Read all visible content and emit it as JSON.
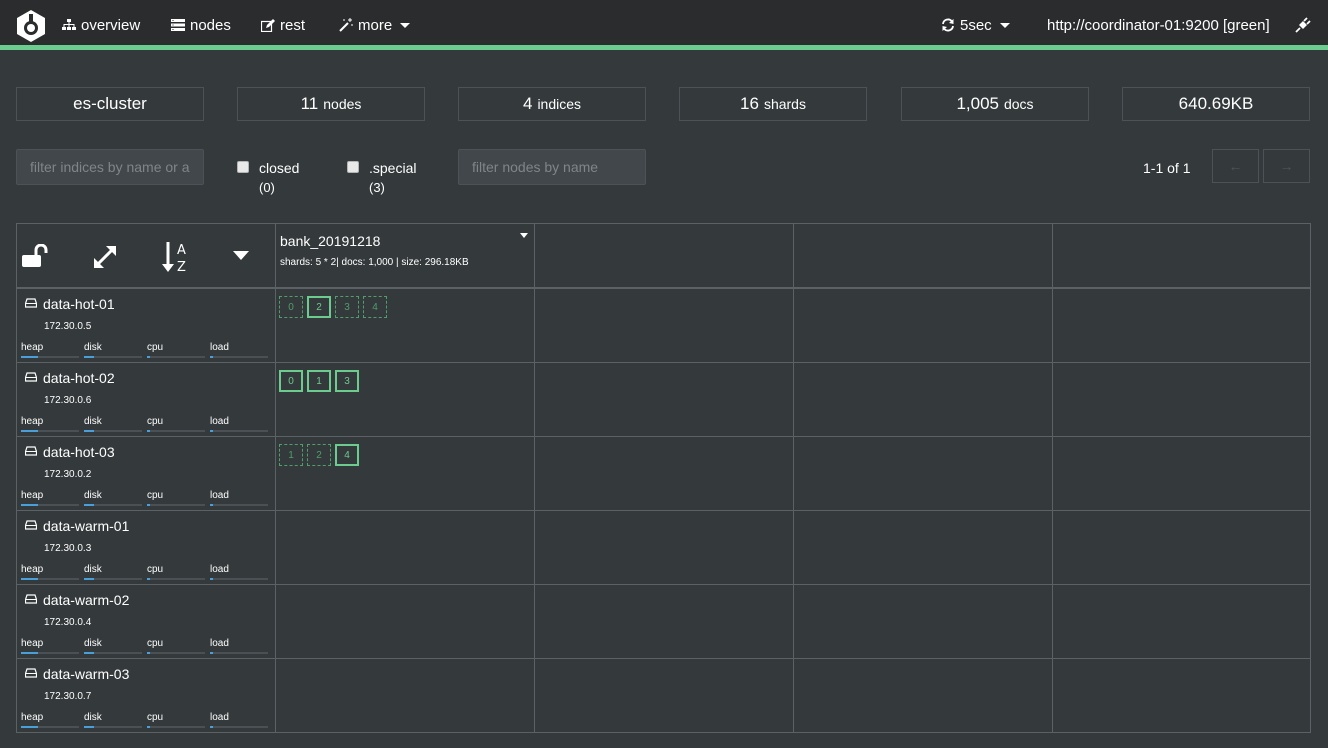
{
  "nav": {
    "overview": "overview",
    "nodes": "nodes",
    "rest": "rest",
    "more": "more",
    "refresh": "5sec",
    "connection": "http://coordinator-01:9200 [green]"
  },
  "stats": {
    "cluster_name": "es-cluster",
    "nodes_count": "11",
    "nodes_label": "nodes",
    "indices_count": "4",
    "indices_label": "indices",
    "shards_count": "16",
    "shards_label": "shards",
    "docs_count": "1,005",
    "docs_label": "docs",
    "size": "640.69KB"
  },
  "filters": {
    "indices_placeholder": "filter indices by name or aliases",
    "closed_label": "closed",
    "closed_count": "(0)",
    "special_label": ".special",
    "special_count": "(3)",
    "nodes_placeholder": "filter nodes by name"
  },
  "pager": {
    "text": "1-1 of 1",
    "prev": "←",
    "next": "→"
  },
  "index": {
    "name": "bank_20191218",
    "meta": "shards: 5 * 2| docs: 1,000 | size: 296.18KB"
  },
  "metric_labels": {
    "heap": "heap",
    "disk": "disk",
    "cpu": "cpu",
    "load": "load"
  },
  "nodes": [
    {
      "name": "data-hot-01",
      "ip": "172.30.0.5",
      "heap": 0.3,
      "disk": 0.17,
      "cpu": 0.05,
      "load": 0.05,
      "shards": [
        {
          "n": "0",
          "p": false
        },
        {
          "n": "2",
          "p": true
        },
        {
          "n": "3",
          "p": false
        },
        {
          "n": "4",
          "p": false
        }
      ]
    },
    {
      "name": "data-hot-02",
      "ip": "172.30.0.6",
      "heap": 0.3,
      "disk": 0.17,
      "cpu": 0.05,
      "load": 0.05,
      "shards": [
        {
          "n": "0",
          "p": true
        },
        {
          "n": "1",
          "p": true
        },
        {
          "n": "3",
          "p": true
        }
      ]
    },
    {
      "name": "data-hot-03",
      "ip": "172.30.0.2",
      "heap": 0.3,
      "disk": 0.17,
      "cpu": 0.05,
      "load": 0.05,
      "shards": [
        {
          "n": "1",
          "p": false
        },
        {
          "n": "2",
          "p": false
        },
        {
          "n": "4",
          "p": true
        }
      ]
    },
    {
      "name": "data-warm-01",
      "ip": "172.30.0.3",
      "heap": 0.3,
      "disk": 0.17,
      "cpu": 0.05,
      "load": 0.05,
      "shards": []
    },
    {
      "name": "data-warm-02",
      "ip": "172.30.0.4",
      "heap": 0.3,
      "disk": 0.17,
      "cpu": 0.05,
      "load": 0.05,
      "shards": []
    },
    {
      "name": "data-warm-03",
      "ip": "172.30.0.7",
      "heap": 0.3,
      "disk": 0.17,
      "cpu": 0.05,
      "load": 0.05,
      "shards": []
    }
  ],
  "colors": {
    "accent": "#6ccb8f",
    "metric_bar": "#4a9fd8",
    "background": "#34393b",
    "navbar": "#2a2c2e"
  }
}
